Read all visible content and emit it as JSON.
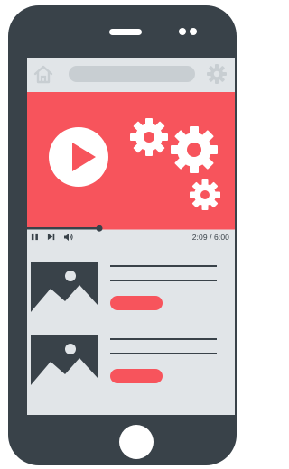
{
  "device": {
    "frame_color": "#394249",
    "screen_color": "#e1e5e8",
    "accent": "#f7545c"
  },
  "browser": {
    "home_icon": "home-icon",
    "settings_icon": "gear-icon"
  },
  "video": {
    "play_icon": "play-icon",
    "decoration_icon": "gears-icon",
    "progress": 0.348,
    "time_label": "2:09 / 6:00"
  },
  "controls": {
    "pause_icon": "pause-icon",
    "next_icon": "skip-next-icon",
    "volume_icon": "volume-icon"
  },
  "list": {
    "items": [
      {
        "thumbnail_icon": "image-placeholder-icon"
      },
      {
        "thumbnail_icon": "image-placeholder-icon"
      }
    ]
  }
}
